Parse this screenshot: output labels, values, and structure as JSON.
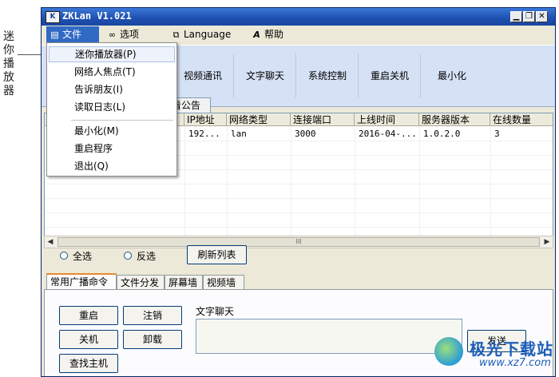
{
  "annotation": {
    "label": "迷你播放器"
  },
  "window": {
    "title": "ZKLan V1.021",
    "logo_letter": "K",
    "controls": {
      "minimize": "▁",
      "restore": "❐",
      "close": "✕"
    }
  },
  "menubar": {
    "file": "文件",
    "options": "选项",
    "language": "Language",
    "help": "帮助"
  },
  "toolbar": {
    "video": "视频通讯",
    "chat": "文字聊天",
    "system": "系统控制",
    "restart": "重启关机",
    "minimize": "最小化"
  },
  "list_tab": {
    "notice": "看公告"
  },
  "table": {
    "columns": [
      "IP地址",
      "网络类型",
      "连接端口",
      "上线时间",
      "服务器版本",
      "在线数量"
    ],
    "rows": [
      [
        "192...",
        "lan",
        "3000",
        "2016-04-...",
        "1.0.2.0",
        "3"
      ]
    ]
  },
  "scroll": {
    "left": "◀",
    "right": "▶",
    "grip": "III"
  },
  "selection": {
    "select_all": "全选",
    "invert": "反选",
    "refresh": "刷新列表"
  },
  "tabs": [
    "常用广播命令",
    "文件分发",
    "屏幕墙",
    "视频墙"
  ],
  "commands": {
    "restart": "重启",
    "logout": "注销",
    "shutdown": "关机",
    "uninstall": "卸载",
    "find_host": "查找主机",
    "chat_label": "文字聊天",
    "send": "发送"
  },
  "file_menu": {
    "items": [
      {
        "label": "迷你播放器(P)"
      },
      {
        "label": "网络人焦点(T)"
      },
      {
        "label": "告诉朋友(I)"
      },
      {
        "label": "读取日志(L)"
      },
      {
        "label": "最小化(M)"
      },
      {
        "label": "重启程序"
      },
      {
        "label": "退出(Q)"
      }
    ]
  },
  "watermark": {
    "title": "极光下载站",
    "url": "www.xz7.com"
  }
}
